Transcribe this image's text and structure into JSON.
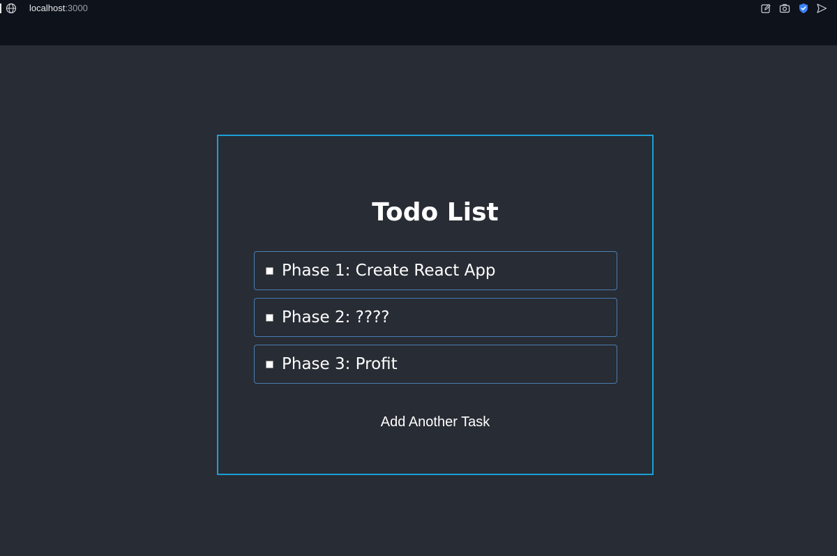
{
  "browser": {
    "url_host": "localhost",
    "url_port": ":3000",
    "icons": [
      "globe-icon",
      "edit-icon",
      "camera-icon",
      "shield-icon",
      "send-icon"
    ]
  },
  "todo": {
    "title": "Todo List",
    "tasks": [
      {
        "label": "Phase 1: Create React App",
        "checked": false
      },
      {
        "label": "Phase 2: ????",
        "checked": false
      },
      {
        "label": "Phase 3: Profit",
        "checked": false
      }
    ],
    "add_label": "Add Another Task"
  },
  "colors": {
    "background": "#282c34",
    "browser_bar": "#0e121b",
    "panel_border": "#1ba0d7",
    "row_border": "#4a7fb5",
    "shield_accent": "#3b82f6"
  }
}
